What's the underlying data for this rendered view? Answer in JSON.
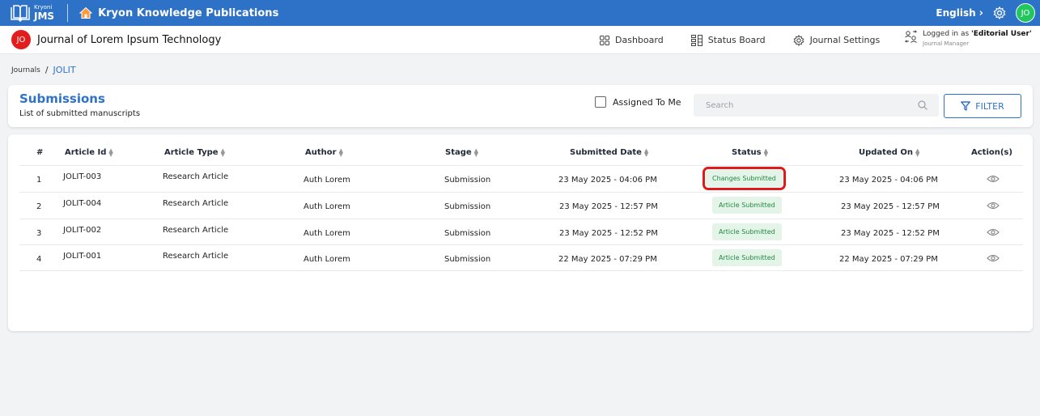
{
  "topbar": {
    "brand_small": "Kryoni",
    "brand_big": "JMS",
    "title": "Kryon Knowledge Publications",
    "language": "English",
    "avatar_initials": "JO",
    "colors": {
      "bar": "#2e72c8",
      "avatar": "#22c55e"
    },
    "icons": [
      "book-logo-icon",
      "home-icon",
      "chevron-right-icon",
      "gear-icon"
    ]
  },
  "subbar": {
    "journal_avatar": "JO",
    "journal_title": "Journal of Lorem Ipsum Technology",
    "nav": [
      {
        "label": "Dashboard",
        "icon": "grid-icon"
      },
      {
        "label": "Status Board",
        "icon": "status-board-icon"
      },
      {
        "label": "Journal Settings",
        "icon": "settings-icon"
      }
    ],
    "logged_prefix": "Logged in as ",
    "logged_role": "'Editorial User'",
    "logged_sub": "Journal Manager"
  },
  "breadcrumb": {
    "root": "Journals",
    "separator": "/",
    "current": "JOLIT"
  },
  "submissions": {
    "title": "Submissions",
    "description": "List of submitted manuscripts",
    "assigned_label": "Assigned To Me",
    "search_placeholder": "Search",
    "filter_label": "FILTER"
  },
  "table": {
    "headers": [
      "#",
      "Article Id",
      "Article Type",
      "Author",
      "Stage",
      "Submitted Date",
      "Status",
      "Updated On",
      "Action(s)"
    ],
    "rows": [
      {
        "num": "1",
        "id": "JOLIT-003",
        "type": "Research Article",
        "author": "Auth Lorem",
        "stage": "Submission",
        "submitted": "23 May 2025 - 04:06 PM",
        "status": "Changes Submitted",
        "updated": "23 May 2025 - 04:06 PM",
        "highlight": true
      },
      {
        "num": "2",
        "id": "JOLIT-004",
        "type": "Research Article",
        "author": "Auth Lorem",
        "stage": "Submission",
        "submitted": "23 May 2025 - 12:57 PM",
        "status": "Article Submitted",
        "updated": "23 May 2025 - 12:57 PM",
        "highlight": false
      },
      {
        "num": "3",
        "id": "JOLIT-002",
        "type": "Research Article",
        "author": "Auth Lorem",
        "stage": "Submission",
        "submitted": "23 May 2025 - 12:52 PM",
        "status": "Article Submitted",
        "updated": "23 May 2025 - 12:52 PM",
        "highlight": false
      },
      {
        "num": "4",
        "id": "JOLIT-001",
        "type": "Research Article",
        "author": "Auth Lorem",
        "stage": "Submission",
        "submitted": "22 May 2025 - 07:29 PM",
        "status": "Article Submitted",
        "updated": "22 May 2025 - 07:29 PM",
        "highlight": false
      }
    ],
    "status_color": "#1e8a3f",
    "highlight_color": "#e01919"
  }
}
